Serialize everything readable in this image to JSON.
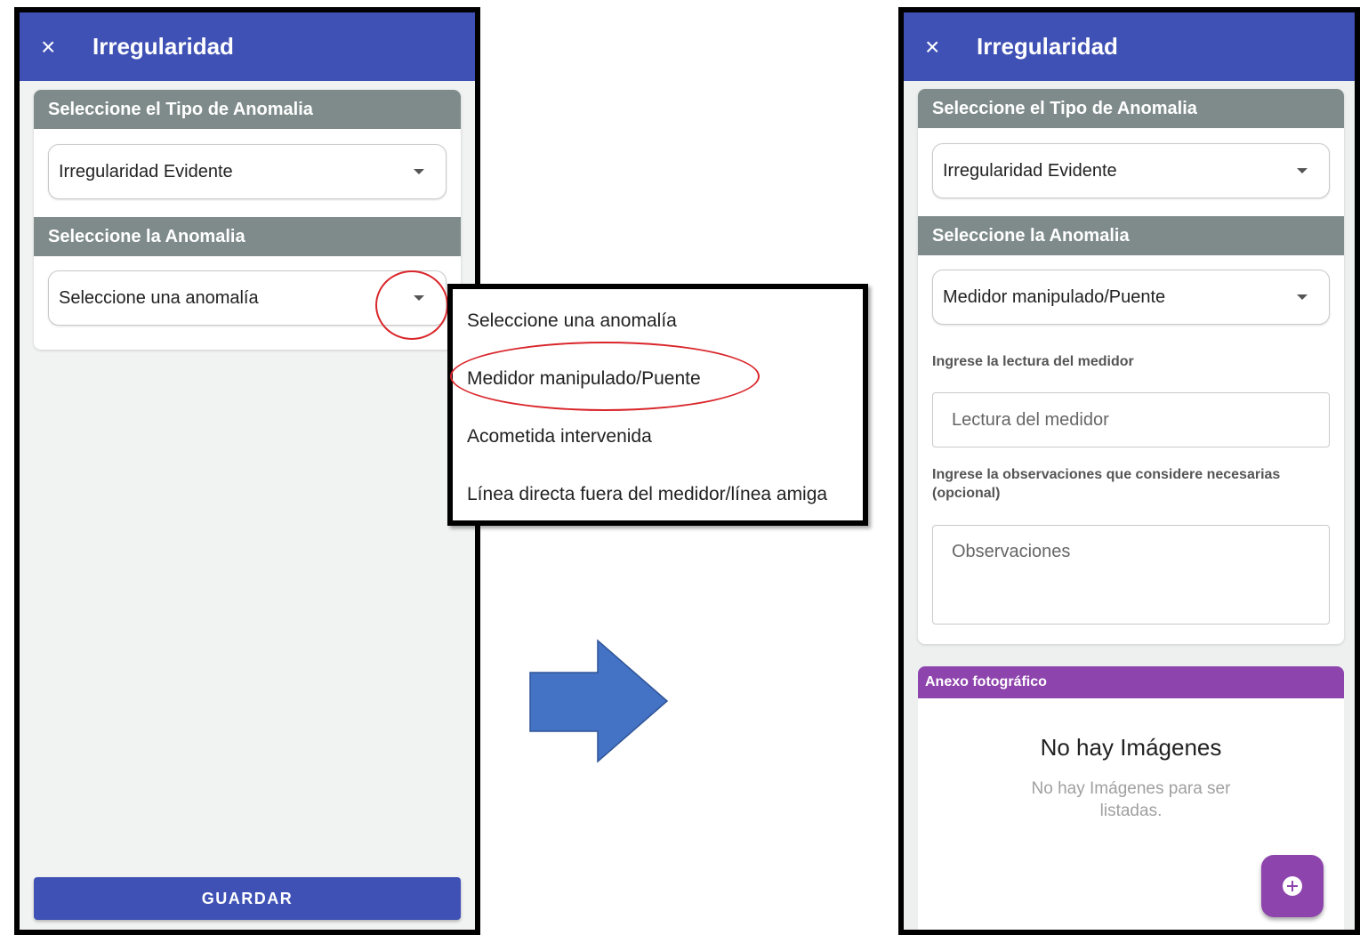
{
  "left_screen": {
    "appbar": {
      "close_glyph": "×",
      "title": "Irregularidad"
    },
    "section_type": {
      "header": "Seleccione el Tipo de Anomalia",
      "selected": "Irregularidad Evidente"
    },
    "section_anomaly": {
      "header": "Seleccione la Anomalia",
      "selected": "Seleccione una anomalía"
    },
    "save_label": "GUARDAR"
  },
  "dropdown": {
    "options": [
      "Seleccione una anomalía",
      "Medidor manipulado/Puente",
      "Acometida intervenida",
      "Línea directa fuera del medidor/línea amiga"
    ],
    "highlighted_option": "Medidor manipulado/Puente"
  },
  "arrow": {
    "color": "#4472c4"
  },
  "right_screen": {
    "appbar": {
      "close_glyph": "×",
      "title": "Irregularidad"
    },
    "section_type": {
      "header": "Seleccione el Tipo de Anomalia",
      "selected": "Irregularidad Evidente"
    },
    "section_anomaly": {
      "header": "Seleccione la Anomalia",
      "selected": "Medidor manipulado/Puente"
    },
    "reading_label": "Ingrese la lectura del medidor",
    "reading_placeholder": "Lectura del medidor",
    "observations_label": "Ingrese la observaciones que considere necesarias (opcional)",
    "observations_placeholder": "Observaciones",
    "annex": {
      "header": "Anexo fotográfico",
      "empty_title": "No hay Imágenes",
      "empty_subtitle": "No hay Imágenes para ser listadas."
    }
  },
  "colors": {
    "appbar": "#3f51b5",
    "section_header": "#7f8b8b",
    "annex_header": "#8e44ad",
    "highlight": "#d9262b"
  }
}
